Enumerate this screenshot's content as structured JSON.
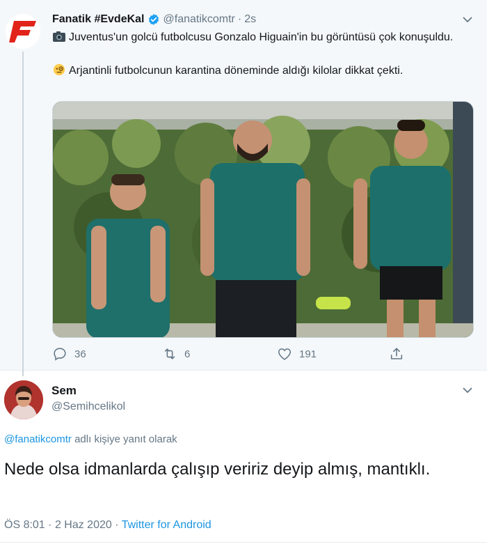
{
  "tweet": {
    "author_name": "Fanatik #EvdeKal",
    "handle": "@fanatikcomtr",
    "separator": "·",
    "time": "2s",
    "line1": "Juventus'un golcü futbolcusu Gonzalo Higuain'in bu görüntüsü çok konuşuldu.",
    "line2": "Arjantinli futbolcunun karantina döneminde aldığı kilolar dikkat çekti.",
    "line1_emoji": "camera-icon",
    "line2_emoji": "monocle-face-icon",
    "actions": {
      "reply_count": "36",
      "retweet_count": "6",
      "like_count": "191"
    }
  },
  "reply": {
    "author_name": "Sem",
    "handle": "@Semihcelikol",
    "reply_to_handle": "@fanatikcomtr",
    "reply_to_suffix": "adlı kişiye yanıt olarak",
    "text": "Nede olsa idmanlarda çalışıp veririz deyip almış, mantıklı.",
    "time": "ÖS 8:01",
    "separator1": "·",
    "date": "2 Haz 2020",
    "separator2": "·",
    "source": "Twitter for Android"
  },
  "colors": {
    "brand": "#e2231a",
    "link": "#1b95e0",
    "muted": "#657786",
    "verified": "#1da1f2"
  }
}
